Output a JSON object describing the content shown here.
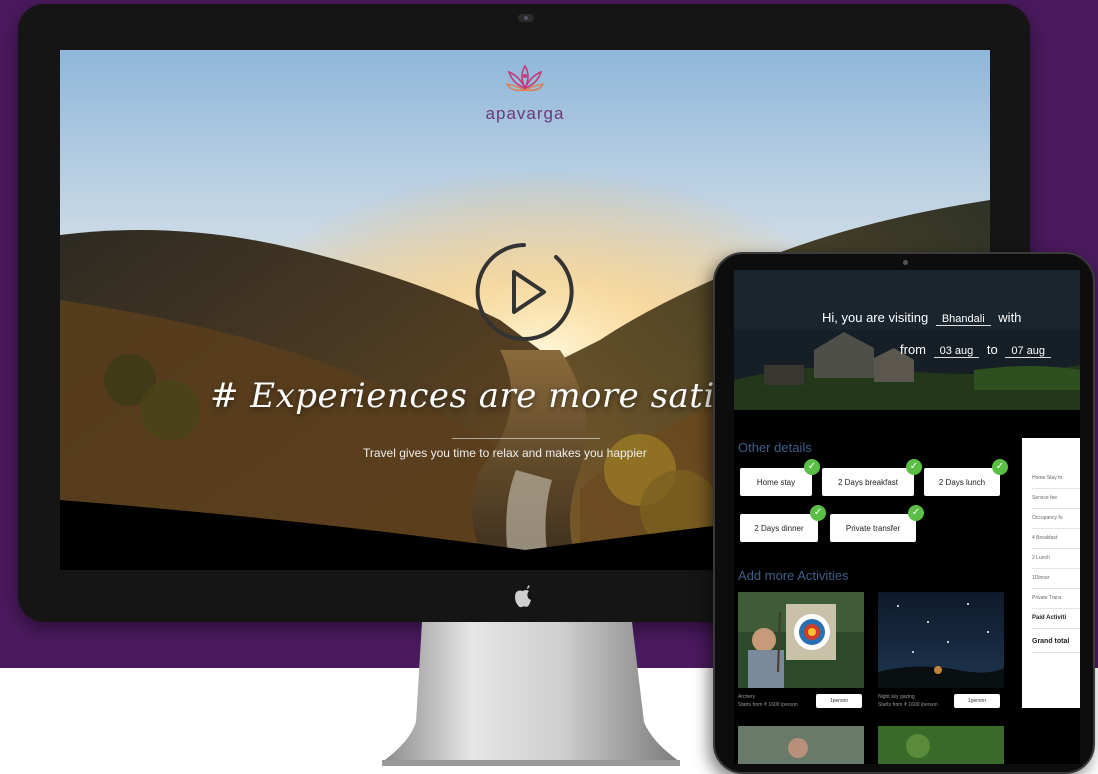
{
  "desktop": {
    "brand": "apavarga",
    "headline": "# Experiences are more satisfing tha",
    "subtitle": "Travel gives you time to relax and makes you happier"
  },
  "tablet": {
    "visit_prefix": "Hi, you are visiting",
    "destination": "Bhandali",
    "with_word": "with",
    "from_word": "from",
    "from_date": "03 aug",
    "to_word": "to",
    "to_date": "07 aug",
    "other_details_title": "Other details",
    "chips": [
      "Home stay",
      "2 Days breakfast",
      "2 Days lunch",
      "2 Days dinner",
      "Private transfer"
    ],
    "add_activities_title": "Add more Activities",
    "activities": [
      {
        "name": "Archery",
        "price": "Starts from ₹ 1600 /person",
        "button": "1person"
      },
      {
        "name": "Night sky gazing",
        "price": "Starts from ₹ 1600 /person",
        "button": "1person"
      }
    ],
    "summary_rows": [
      "Home Stay fo",
      "Service fee",
      "Occupancy fo",
      "4 Breakfast",
      "2 Lunch",
      "1Dinner",
      "Private Trans",
      "Paid Activiti",
      "Grand total"
    ]
  },
  "colors": {
    "background": "#4a1a5e",
    "section_title": "#3f5e8a",
    "check_green": "#5bbf45"
  }
}
